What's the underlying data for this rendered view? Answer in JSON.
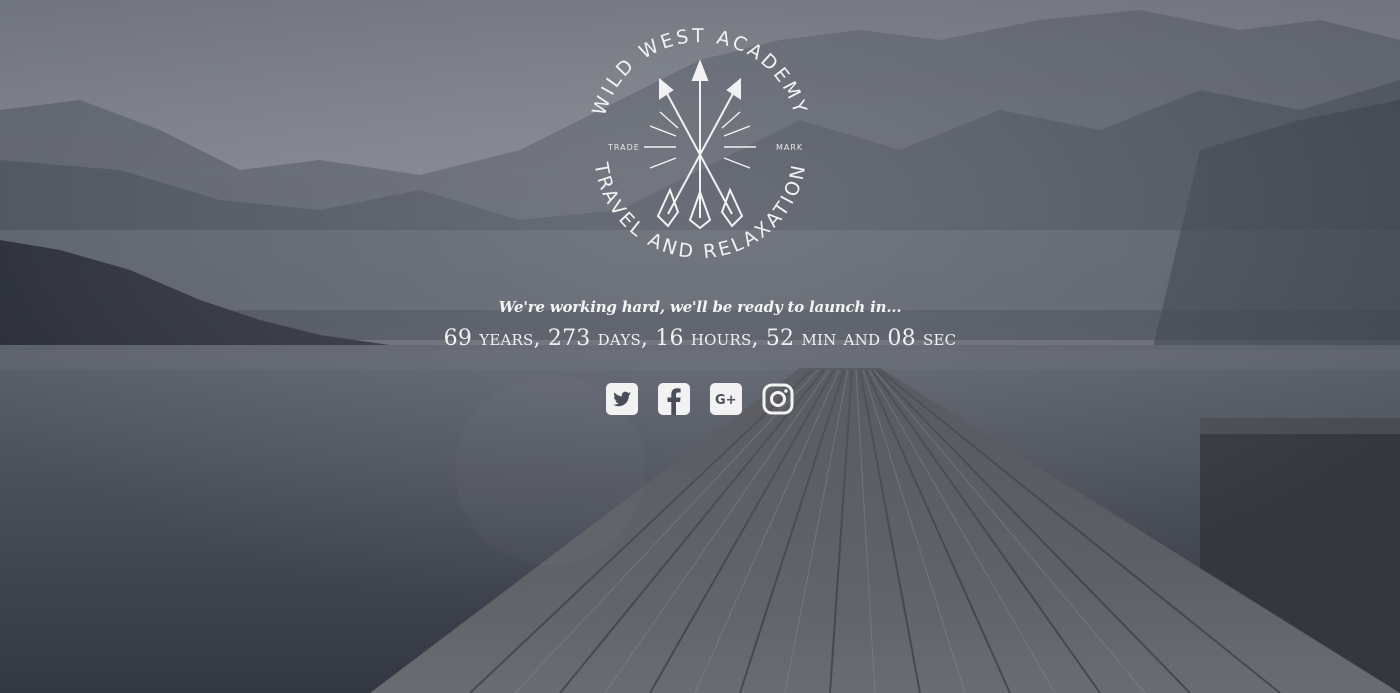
{
  "logo": {
    "top_text": "WILD WEST ACADEMY",
    "bottom_text": "TRAVEL AND RELAXATION",
    "left_mark": "TRADE",
    "right_mark": "MARK"
  },
  "tagline": "We're working hard, we'll be ready to launch in...",
  "countdown": "69 years, 273 days, 16 hours, 52 min and 08 sec",
  "social": [
    {
      "icon": "twitter-icon"
    },
    {
      "icon": "facebook-icon"
    },
    {
      "icon": "google-plus-icon"
    },
    {
      "icon": "instagram-icon"
    }
  ],
  "colors": {
    "sky": "#7b7f88",
    "water": "#3d424c",
    "mountains": "#545965",
    "dock": "#5a5d63",
    "text": "#f2f2f2"
  }
}
